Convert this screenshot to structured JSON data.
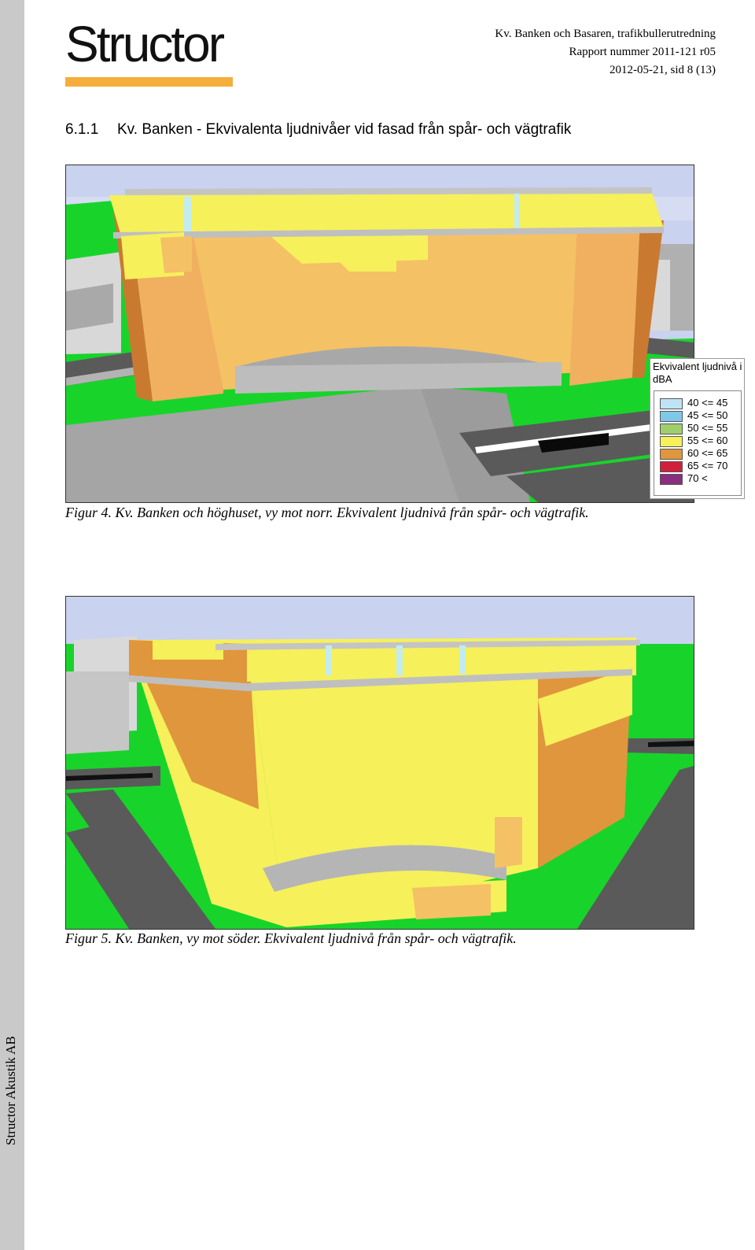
{
  "sidebar": {
    "text": "Structor Akustik AB"
  },
  "logo": {
    "text": "Structor",
    "bar_color": "#f5ad3b"
  },
  "header": {
    "line1": "Kv. Banken och Basaren, trafikbullerutredning",
    "line2": "Rapport nummer 2011-121 r05",
    "line3": "2012-05-21, sid 8 (13)"
  },
  "section": {
    "number": "6.1.1",
    "title": "Kv. Banken - Ekvivalenta ljudnivåer vid fasad från spår- och vägtrafik"
  },
  "figure1": {
    "caption": "Figur 4. Kv. Banken och höghuset, vy mot norr. Ekvivalent ljudnivå från spår- och vägtrafik."
  },
  "figure2": {
    "caption": "Figur 5. Kv. Banken, vy mot söder. Ekvivalent ljudnivå från spår- och vägtrafik."
  },
  "legend": {
    "title": "Ekvivalent ljudnivå i dBA",
    "items": [
      {
        "label": "40 <= 45",
        "color": "#bfe3f5"
      },
      {
        "label": "45 <= 50",
        "color": "#7fc8ea"
      },
      {
        "label": "50 <= 55",
        "color": "#9fcf6a"
      },
      {
        "label": "55 <= 60",
        "color": "#f6f05a"
      },
      {
        "label": "60 <= 65",
        "color": "#e0963c"
      },
      {
        "label": "65 <= 70",
        "color": "#d21f3c"
      },
      {
        "label": "70 <",
        "color": "#8a2f7e"
      }
    ]
  }
}
